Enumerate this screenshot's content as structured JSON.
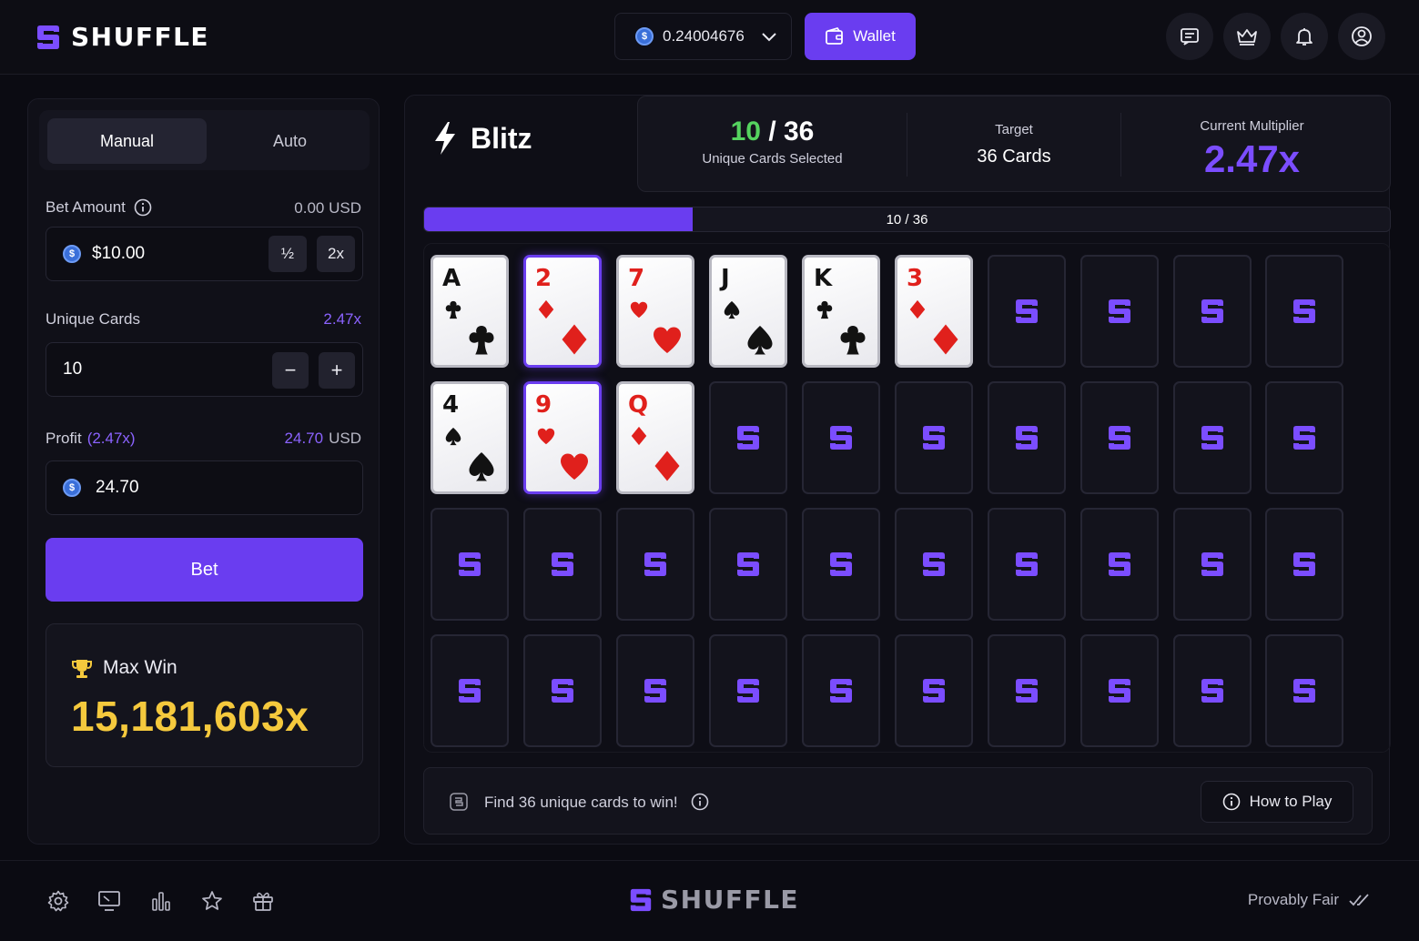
{
  "header": {
    "logo_text": "SHUFFLE",
    "balance": "0.24004676",
    "wallet_label": "Wallet",
    "icons": [
      "chat-icon",
      "crown-icon",
      "bell-icon",
      "user-icon"
    ]
  },
  "left_panel": {
    "tabs": [
      "Manual",
      "Auto"
    ],
    "active_tab": "Manual",
    "bet_amount_label": "Bet Amount",
    "bet_amount_usd": "0.00 USD",
    "bet_amount_value": "$10.00",
    "half_label": "½",
    "double_label": "2x",
    "unique_cards_label": "Unique Cards",
    "unique_cards_multiplier": "2.47x",
    "unique_cards_value": "10",
    "minus_label": "−",
    "plus_label": "+",
    "profit_label": "Profit",
    "profit_multiplier": "(2.47x)",
    "profit_usd_value": "24.70",
    "profit_usd_unit": "USD",
    "profit_value": "24.70",
    "bet_button": "Bet",
    "max_win_label": "Max Win",
    "max_win_value": "15,181,603x"
  },
  "game": {
    "title": "Blitz",
    "selected_count": "10",
    "selected_total": "/ 36",
    "selected_label": "Unique Cards Selected",
    "target_label": "Target",
    "target_value": "36 Cards",
    "multiplier_label": "Current Multiplier",
    "multiplier_value": "2.47x",
    "progress_text": "10 / 36",
    "progress_fraction": 0.2778,
    "cards": [
      {
        "rank": "A",
        "suit": "clubs",
        "selected": false
      },
      {
        "rank": "2",
        "suit": "diamonds",
        "selected": true
      },
      {
        "rank": "7",
        "suit": "hearts",
        "selected": false
      },
      {
        "rank": "J",
        "suit": "spades",
        "selected": false
      },
      {
        "rank": "K",
        "suit": "clubs",
        "selected": false
      },
      {
        "rank": "3",
        "suit": "diamonds",
        "selected": false
      },
      null,
      null,
      null,
      null,
      {
        "rank": "4",
        "suit": "spades",
        "selected": false
      },
      {
        "rank": "9",
        "suit": "hearts",
        "selected": true
      },
      {
        "rank": "Q",
        "suit": "diamonds",
        "selected": false
      },
      null,
      null,
      null,
      null,
      null,
      null,
      null,
      null,
      null,
      null,
      null,
      null,
      null,
      null,
      null,
      null,
      null,
      null,
      null,
      null,
      null,
      null,
      null,
      null,
      null,
      null,
      null
    ],
    "footer_text": "Find 36 unique cards to win!",
    "how_to_play": "How to Play"
  },
  "bottom": {
    "logo_text": "SHUFFLE",
    "provably_fair": "Provably Fair",
    "icons": [
      "settings-icon",
      "monitor-icon",
      "stats-icon",
      "star-icon",
      "gift-icon"
    ]
  },
  "colors": {
    "accent": "#6a3df0",
    "green": "#55d35f",
    "gold": "#f5c93d",
    "purple_text": "#8b63ff"
  }
}
